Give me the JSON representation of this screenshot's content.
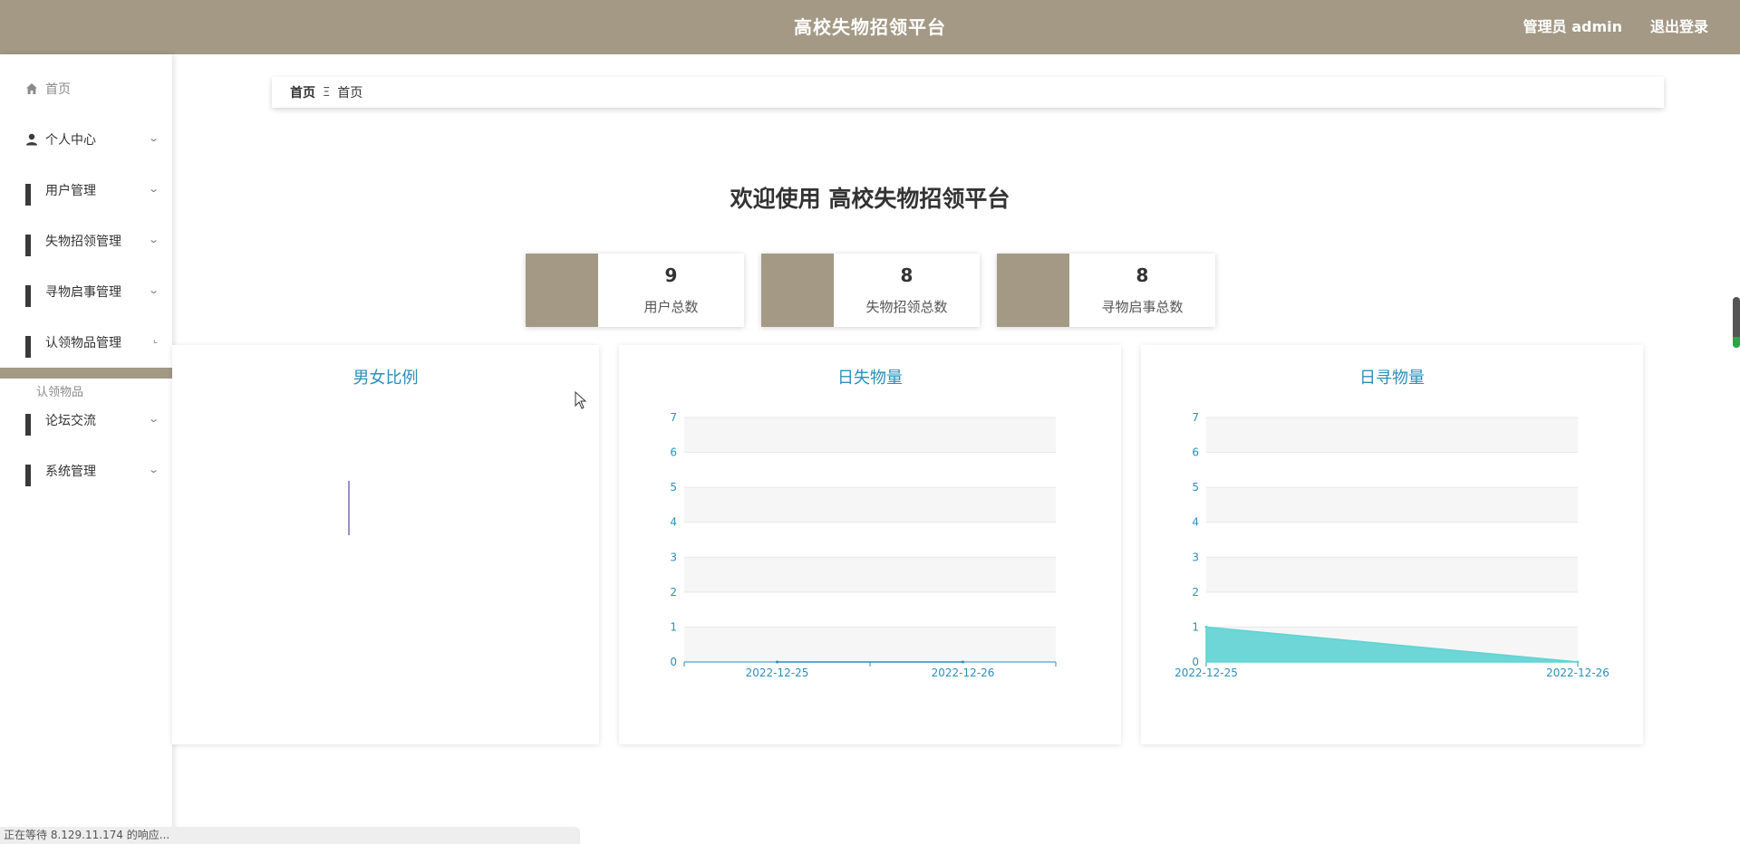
{
  "header": {
    "title": "高校失物招领平台",
    "user": "管理员 admin",
    "logout": "退出登录"
  },
  "sidebar": {
    "items": [
      {
        "label": "首页",
        "icon": "home-icon"
      },
      {
        "label": "个人中心",
        "icon": "user-icon"
      },
      {
        "label": "用户管理",
        "icon": "grid-icon"
      },
      {
        "label": "失物招领管理",
        "icon": "grid-icon"
      },
      {
        "label": "寻物启事管理",
        "icon": "grid-icon"
      },
      {
        "label": "认领物品管理",
        "icon": "grid-icon"
      },
      {
        "label": "论坛交流",
        "icon": "grid-icon"
      },
      {
        "label": "系统管理",
        "icon": "grid-icon"
      }
    ],
    "submenu": {
      "label": "认领物品"
    },
    "accent": "#a39985"
  },
  "breadcrumb": {
    "first": "首页",
    "separator": "Ξ",
    "second": "首页"
  },
  "welcome": "欢迎使用 高校失物招领平台",
  "stats": [
    {
      "value": "9",
      "label": "用户总数"
    },
    {
      "value": "8",
      "label": "失物招领总数"
    },
    {
      "value": "8",
      "label": "寻物启事总数"
    }
  ],
  "chart_data": [
    {
      "type": "pie",
      "title": "男女比例",
      "slices": []
    },
    {
      "type": "area",
      "title": "日失物量",
      "x": [
        "2022-12-25",
        "2022-12-26"
      ],
      "ylim": [
        0,
        7
      ],
      "yticks": [
        0,
        1,
        2,
        3,
        4,
        5,
        6,
        7
      ],
      "series": [
        {
          "values": [
            0,
            0
          ]
        }
      ],
      "xaxis_boundary_gap": true,
      "color": "#2a8fbd"
    },
    {
      "type": "area",
      "title": "日寻物量",
      "x": [
        "2022-12-25",
        "2022-12-26"
      ],
      "ylim": [
        0,
        7
      ],
      "yticks": [
        0,
        1,
        2,
        3,
        4,
        5,
        6,
        7
      ],
      "series": [
        {
          "values": [
            1,
            0
          ]
        }
      ],
      "xaxis_boundary_gap": false,
      "color": "#5fd3d3"
    }
  ],
  "status_bar": "正在等待 8.129.11.174 的响应..."
}
